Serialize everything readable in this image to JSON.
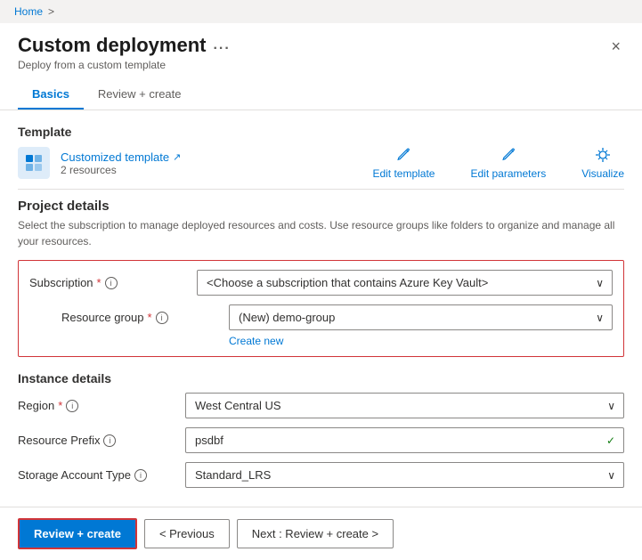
{
  "breadcrumb": {
    "home": "Home",
    "separator": ">"
  },
  "header": {
    "title": "Custom deployment",
    "subtitle": "Deploy from a custom template",
    "ellipsis": "...",
    "close_label": "×"
  },
  "tabs": [
    {
      "id": "basics",
      "label": "Basics",
      "active": true
    },
    {
      "id": "review-create",
      "label": "Review + create",
      "active": false
    }
  ],
  "template_section": {
    "title": "Template",
    "icon_alt": "template-icon",
    "template_name": "Customized template",
    "template_ext_icon": "↗",
    "template_resources": "2 resources",
    "actions": [
      {
        "id": "edit-template",
        "label": "Edit template",
        "icon": "pencil"
      },
      {
        "id": "edit-parameters",
        "label": "Edit parameters",
        "icon": "pencil"
      },
      {
        "id": "visualize",
        "label": "Visualize",
        "icon": "visualize"
      }
    ]
  },
  "project_details": {
    "title": "Project details",
    "description": "Select the subscription to manage deployed resources and costs. Use resource groups like folders to organize and manage all your resources.",
    "fields": [
      {
        "id": "subscription",
        "label": "Subscription",
        "required": true,
        "has_info": true,
        "value": "<Choose a subscription that contains Azure Key Vault>",
        "type": "select"
      },
      {
        "id": "resource-group",
        "label": "Resource group",
        "required": true,
        "has_info": true,
        "value": "(New) demo-group",
        "type": "select",
        "create_new": "Create new",
        "indented": true
      }
    ]
  },
  "instance_details": {
    "title": "Instance details",
    "fields": [
      {
        "id": "region",
        "label": "Region",
        "required": true,
        "has_info": true,
        "value": "West Central US",
        "type": "select"
      },
      {
        "id": "resource-prefix",
        "label": "Resource Prefix",
        "required": false,
        "has_info": true,
        "value": "psdbf",
        "type": "select",
        "has_check": true
      },
      {
        "id": "storage-account-type",
        "label": "Storage Account Type",
        "required": false,
        "has_info": true,
        "value": "Standard_LRS",
        "type": "select"
      }
    ]
  },
  "footer": {
    "review_create_label": "Review + create",
    "previous_label": "< Previous",
    "next_label": "Next : Review + create >"
  }
}
